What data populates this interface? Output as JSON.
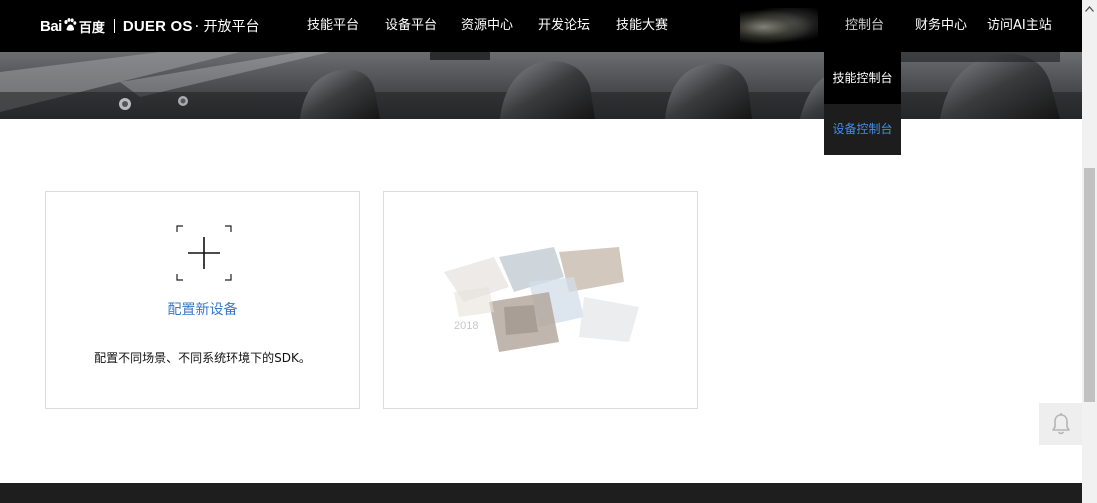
{
  "header": {
    "logo": {
      "baidu_text": "Bai",
      "baidu_cn": "百度",
      "duer_text": "DUER OS",
      "platform_text": "· 开放平台"
    },
    "nav": [
      {
        "label": "技能平台"
      },
      {
        "label": "设备平台"
      },
      {
        "label": "资源中心"
      },
      {
        "label": "开发论坛"
      },
      {
        "label": "技能大赛"
      }
    ],
    "console": {
      "label": "控制台"
    },
    "finance": {
      "label": "财务中心"
    },
    "visit_ai": {
      "label": "访问AI主站"
    },
    "nav_blurred_icon": "user-avatar-icon"
  },
  "dropdown": {
    "items": [
      {
        "label": "技能控制台",
        "selected": false
      },
      {
        "label": "设备控制台",
        "selected": true
      }
    ],
    "selected_color": "#3d8ef0"
  },
  "cards": {
    "add": {
      "icon": "plus-icon",
      "title": "配置新设备",
      "description": "配置不同场景、不同系统环境下的SDK。"
    },
    "device": {
      "image": "device-thumbnail",
      "year_label": "2018"
    }
  },
  "colors": {
    "topbar": "#000000",
    "link_blue": "#3a78c9",
    "footer": "#1e1e1e"
  },
  "notification": {
    "icon": "bell-icon"
  }
}
